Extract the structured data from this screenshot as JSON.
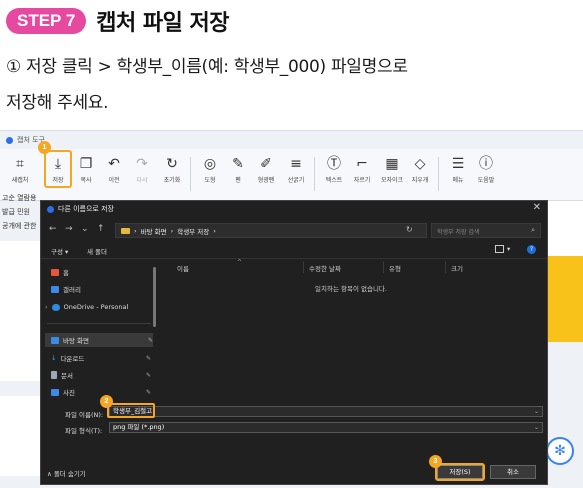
{
  "header": {
    "step_badge": "STEP 7",
    "title": "캡처 파일 저장",
    "line1": "① 저장 클릭 > 학생부_이름(예: 학생부_000) 파일명으로",
    "line2": "저장해 주세요."
  },
  "app": {
    "title": "캡처 도구",
    "toolbar": [
      {
        "label": "새캡처",
        "icon": "crop-icon",
        "glyph": "⌗"
      },
      {
        "label": "저장",
        "icon": "download-icon",
        "glyph": "⤓"
      },
      {
        "label": "복사",
        "icon": "copy-icon",
        "glyph": "❐"
      },
      {
        "label": "이전",
        "icon": "undo-icon",
        "glyph": "↶"
      },
      {
        "label": "다시",
        "icon": "redo-icon",
        "glyph": "↷"
      },
      {
        "label": "초기화",
        "icon": "refresh-icon",
        "glyph": "↻"
      },
      {
        "label": "도형",
        "icon": "shapes-icon",
        "glyph": "◎"
      },
      {
        "label": "펜",
        "icon": "pen-icon",
        "glyph": "✎"
      },
      {
        "label": "형광펜",
        "icon": "highlighter-icon",
        "glyph": "✐"
      },
      {
        "label": "선굵기",
        "icon": "line-weight-icon",
        "glyph": "≡"
      },
      {
        "label": "텍스트",
        "icon": "text-icon",
        "glyph": "Ⓣ"
      },
      {
        "label": "자르기",
        "icon": "crop-tool-icon",
        "glyph": "⌐"
      },
      {
        "label": "모자이크",
        "icon": "mosaic-icon",
        "glyph": "▦"
      },
      {
        "label": "지우개",
        "icon": "eraser-icon",
        "glyph": "◇"
      },
      {
        "label": "메뉴",
        "icon": "menu-icon",
        "glyph": "☰"
      },
      {
        "label": "도움말",
        "icon": "info-icon",
        "glyph": "ⓘ"
      }
    ],
    "bg_left_lines": [
      "고순 열람용",
      "발급 민원",
      "공개에 관한"
    ]
  },
  "dialog": {
    "title": "다른 이름으로 저장",
    "path": [
      "바탕 화면",
      "학생부 저장"
    ],
    "search_placeholder": "학생부 저장 검색",
    "organize": "구성 ▾",
    "new_folder": "새 폴더",
    "nav_items": [
      {
        "label": "홈",
        "icon": "home-icon",
        "color": "#e8553c"
      },
      {
        "label": "갤러리",
        "icon": "gallery-icon",
        "color": "#3c8ae8"
      },
      {
        "label": "OneDrive - Personal",
        "icon": "cloud-icon",
        "color": "#2d8ce0"
      },
      {
        "label": "바탕 화면",
        "icon": "desktop-icon",
        "color": "#3c8ae8"
      },
      {
        "label": "다운로드",
        "icon": "download-folder-icon",
        "color": "#3ca0e8"
      },
      {
        "label": "문서",
        "icon": "document-icon",
        "color": "#9aa7b8"
      },
      {
        "label": "사진",
        "icon": "picture-icon",
        "color": "#3c8ae8"
      }
    ],
    "columns": [
      "이름",
      "수정한 날짜",
      "유형",
      "크기"
    ],
    "empty_message": "일치하는 항목이 없습니다.",
    "filename_label": "파일 이름(N):",
    "filename_value": "학생부_김철고",
    "filetype_label": "파일 형식(T):",
    "filetype_value": "png 파일 (*.png)",
    "hide_folders": "∧ 폴더 숨기기",
    "save_button": "저장(S)",
    "cancel_button": "취소"
  },
  "markers": [
    "1",
    "2",
    "3"
  ],
  "colors": {
    "accent": "#f5a623",
    "badge": "#e54aa0"
  }
}
